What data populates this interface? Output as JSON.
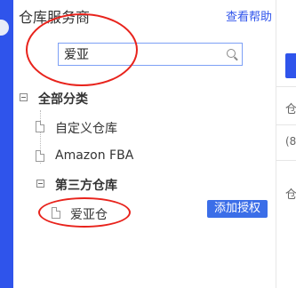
{
  "header": {
    "title": "仓库服务商",
    "help_link": "查看帮助"
  },
  "search": {
    "value": "爱亚",
    "placeholder": ""
  },
  "tree": {
    "root": {
      "label": "全部分类"
    },
    "items": [
      {
        "label": "自定义仓库"
      },
      {
        "label": "Amazon FBA"
      }
    ],
    "group": {
      "label": "第三方仓库",
      "children": [
        {
          "label": "爱亚仓",
          "action": "添加授权"
        }
      ]
    }
  },
  "right_panel": {
    "chars": [
      "仓",
      "(8",
      "仓"
    ]
  },
  "colors": {
    "accent": "#2f54eb",
    "button": "#3b6ee8",
    "annotation": "#e8231c"
  }
}
